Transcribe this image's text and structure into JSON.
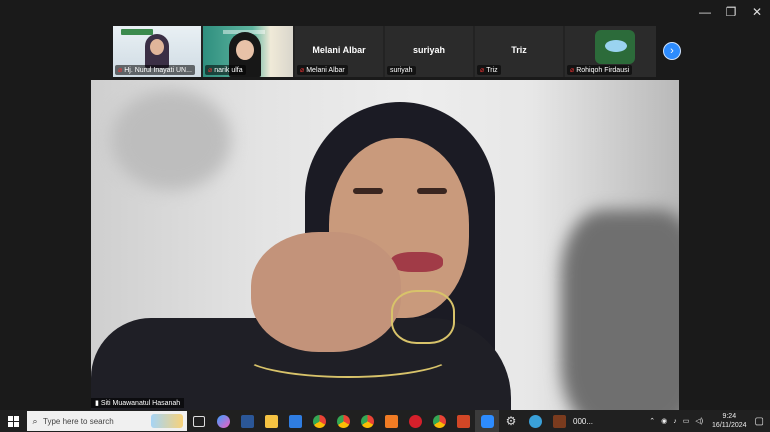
{
  "window": {
    "minimize": "—",
    "restore": "❐",
    "close": "✕"
  },
  "participants": [
    {
      "label": "Hj. Nurul Inayati UN...",
      "type": "video"
    },
    {
      "label": "narik ulfa",
      "type": "video"
    },
    {
      "title": "Melani Albar",
      "label": "Melani Albar",
      "type": "name"
    },
    {
      "title": "suriyah",
      "label": "suriyah",
      "type": "name"
    },
    {
      "title": "Triz",
      "label": "Triz",
      "type": "name"
    },
    {
      "label": "Rohiqoh Firdausi",
      "type": "avatar"
    }
  ],
  "next_button": "›",
  "active_speaker": "Siti Muawanatul Hasanah",
  "taskbar": {
    "search_placeholder": "Type here to search",
    "zoom_label": "000...",
    "time": "9:24",
    "date": "16/11/2024"
  }
}
